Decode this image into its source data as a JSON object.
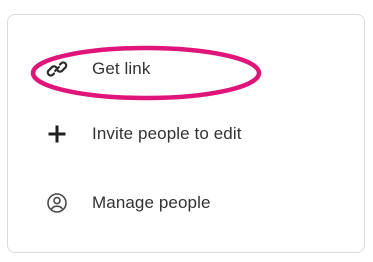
{
  "menu": {
    "items": [
      {
        "label": "Get link",
        "icon": "link-icon"
      },
      {
        "label": "Invite people to edit",
        "icon": "plus-icon"
      },
      {
        "label": "Manage people",
        "icon": "people-circle-icon"
      }
    ]
  },
  "colors": {
    "highlight": "#e0157a",
    "text": "#333333",
    "border": "#dcdcdc"
  }
}
